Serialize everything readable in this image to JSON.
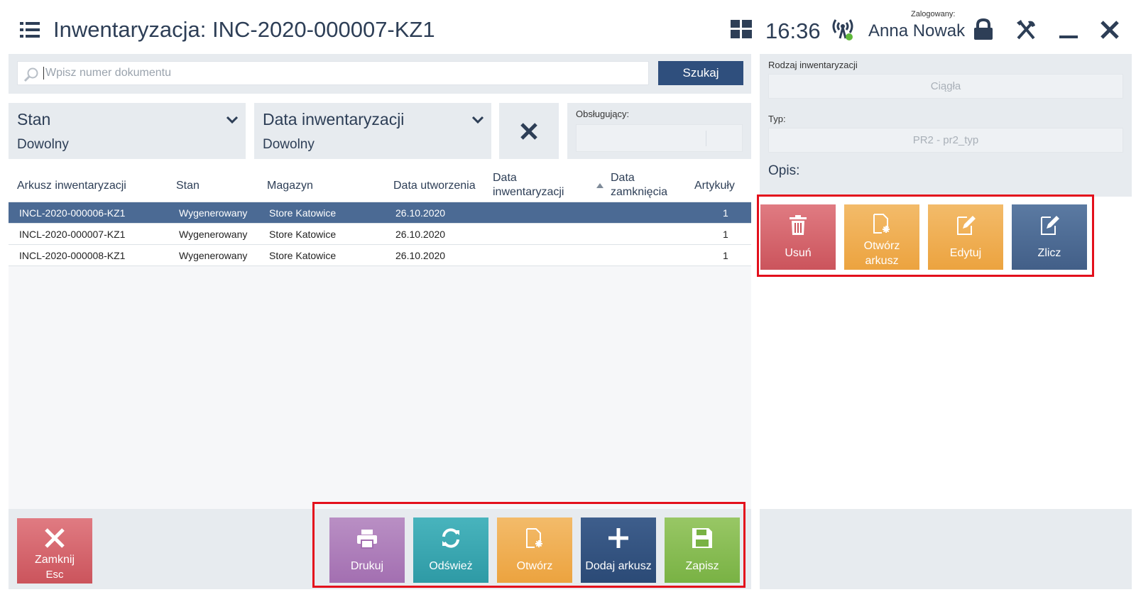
{
  "header": {
    "title": "Inwentaryzacja: INC-2020-000007-KZ1",
    "time": "16:36",
    "logged_label": "Zalogowany:",
    "user_name": "Anna Nowak"
  },
  "search": {
    "placeholder": "Wpisz numer dokumentu",
    "button_label": "Szukaj"
  },
  "filters": {
    "status": {
      "label": "Stan",
      "value": "Dowolny"
    },
    "inventory_date": {
      "label": "Data inwentaryzacji",
      "value": "Dowolny"
    },
    "handler_label": "Obsługujący:"
  },
  "table": {
    "columns": {
      "sheet": "Arkusz inwentaryzacji",
      "status": "Stan",
      "warehouse": "Magazyn",
      "created": "Data utworzenia",
      "inventory_date_1": "Data",
      "inventory_date_2": "inwentaryzacji",
      "closing_date_1": "Data",
      "closing_date_2": "zamknięcia",
      "items": "Artykuły"
    },
    "rows": [
      {
        "sheet": "INCL-2020-000006-KZ1",
        "status": "Wygenerowany",
        "warehouse": "Store Katowice",
        "created": "26.10.2020",
        "inventory_date": "",
        "closing_date": "",
        "items": "1"
      },
      {
        "sheet": "INCL-2020-000007-KZ1",
        "status": "Wygenerowany",
        "warehouse": "Store Katowice",
        "created": "26.10.2020",
        "inventory_date": "",
        "closing_date": "",
        "items": "1"
      },
      {
        "sheet": "INCL-2020-000008-KZ1",
        "status": "Wygenerowany",
        "warehouse": "Store Katowice",
        "created": "26.10.2020",
        "inventory_date": "",
        "closing_date": "",
        "items": "1"
      }
    ]
  },
  "footer": {
    "close_line1": "Zamknij",
    "close_line2": "Esc",
    "print": "Drukuj",
    "refresh": "Odśwież",
    "open": "Otwórz",
    "add_sheet": "Dodaj arkusz",
    "save": "Zapisz"
  },
  "details": {
    "type_label": "Rodzaj inwentaryzacji",
    "type_value": "Ciągła",
    "kind_label": "Typ:",
    "kind_value": "PR2 - pr2_typ",
    "description_label": "Opis:"
  },
  "sheet_actions": {
    "delete": "Usuń",
    "open_line1": "Otwórz",
    "open_line2": "arkusz",
    "edit": "Edytuj",
    "count": "Zlicz"
  },
  "colors": {
    "navy": "#2f4f7d",
    "selected_row": "#4b6a94",
    "panel": "#e7ebef",
    "highlight": "#e3101c"
  }
}
